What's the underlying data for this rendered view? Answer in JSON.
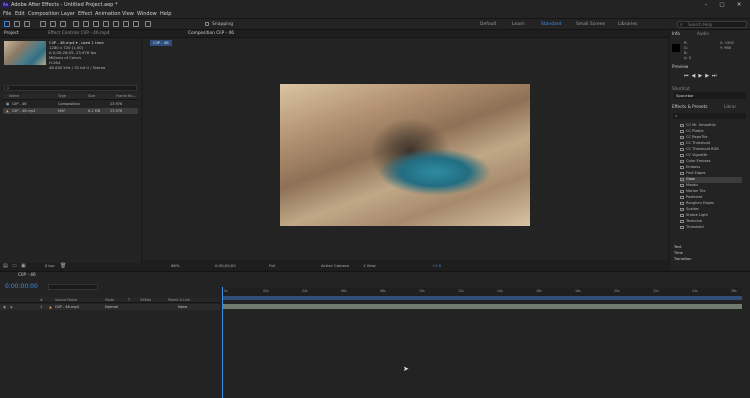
{
  "window": {
    "app_icon": "Ae",
    "title": "Adobe After Effects - Untitled Project.aep *",
    "min": "–",
    "max": "▢",
    "close": "✕"
  },
  "menu": [
    "File",
    "Edit",
    "Composition",
    "Layer",
    "Effect",
    "Animation",
    "View",
    "Window",
    "Help"
  ],
  "toolbar": {
    "snapping": "Snapping",
    "workspaces": [
      "Default",
      "Learn",
      "Standard",
      "Small Screen",
      "Libraries"
    ],
    "active_workspace": "Standard",
    "search_placeholder": "Search Help"
  },
  "project": {
    "tab": "Project",
    "effect_tab": "Effect Controls CliP - 46.mp4",
    "item_name": "CliP - 46.mp4 ▾ , used 1 time",
    "item_meta": [
      "1280 x 720 (1.00)",
      "Δ 0;00;26;05, 23.976 fps",
      "Millions of Colors",
      "H.264",
      "48.000 kHz / 32 bit U / Stereo"
    ],
    "search_placeholder": "ρ.",
    "columns": [
      "Name",
      "Type",
      "Size",
      "Frame Ra..."
    ],
    "rows": [
      {
        "name": "CliP - 46",
        "type": "Composition",
        "size": "",
        "fps": "23.976"
      },
      {
        "name": "CliP - 46.mp4",
        "type": "MXF",
        "size": "6.1 MB",
        "fps": "23.976"
      }
    ],
    "bpc": "8 bpc"
  },
  "composition": {
    "tab": "Composition CliP - 46",
    "breadcrumb": "CliP - 46",
    "zoom": "66%",
    "time": "0;00;00;00",
    "resolution": "Full",
    "camera": "Active Camera",
    "views": "1 View",
    "exposure": "+0.0"
  },
  "right": {
    "info_tab": "Info",
    "audio_tab": "Audio",
    "info_vals": [
      "R:",
      "G:",
      "B:",
      "A: 0"
    ],
    "coords": [
      "X: 1592",
      "Y: 968"
    ],
    "preview": "Preview",
    "shortcut_label": "Shortcut",
    "shortcut_val": "Spacebar",
    "fx_tab": "Effects & Presets",
    "lib_tab": "Librar",
    "fx_search": "ρ.",
    "fx_items": [
      "CC Mr. Smoothie",
      "CC Plastic",
      "CC RepeTile",
      "CC Threshold",
      "CC Threshold RGB",
      "CC Vignette",
      "Color Emboss",
      "Emboss",
      "Find Edges",
      "Glow",
      "Mosaic",
      "Motion Tile",
      "Posterize",
      "Roughen Edges",
      "Scatter",
      "Strobe Light",
      "Texturize",
      "Threshold"
    ],
    "fx_selected": "Glow",
    "groups": [
      "Text",
      "Time",
      "Transition"
    ]
  },
  "timeline": {
    "tab": "CliP - 46",
    "timecode": "0;00;00;00",
    "columns": [
      "#",
      "Source Name",
      "Mode",
      "T",
      "TrkMat",
      "Parent & Link"
    ],
    "layer": {
      "num": "1",
      "name": "CliP - 46.mp4",
      "mode": "Normal",
      "parent": "None"
    },
    "ticks": [
      "0s",
      "02s",
      "04s",
      "06s",
      "08s",
      "10s",
      "12s",
      "14s",
      "16s",
      "18s",
      "20s",
      "22s",
      "24s",
      "26s"
    ]
  }
}
